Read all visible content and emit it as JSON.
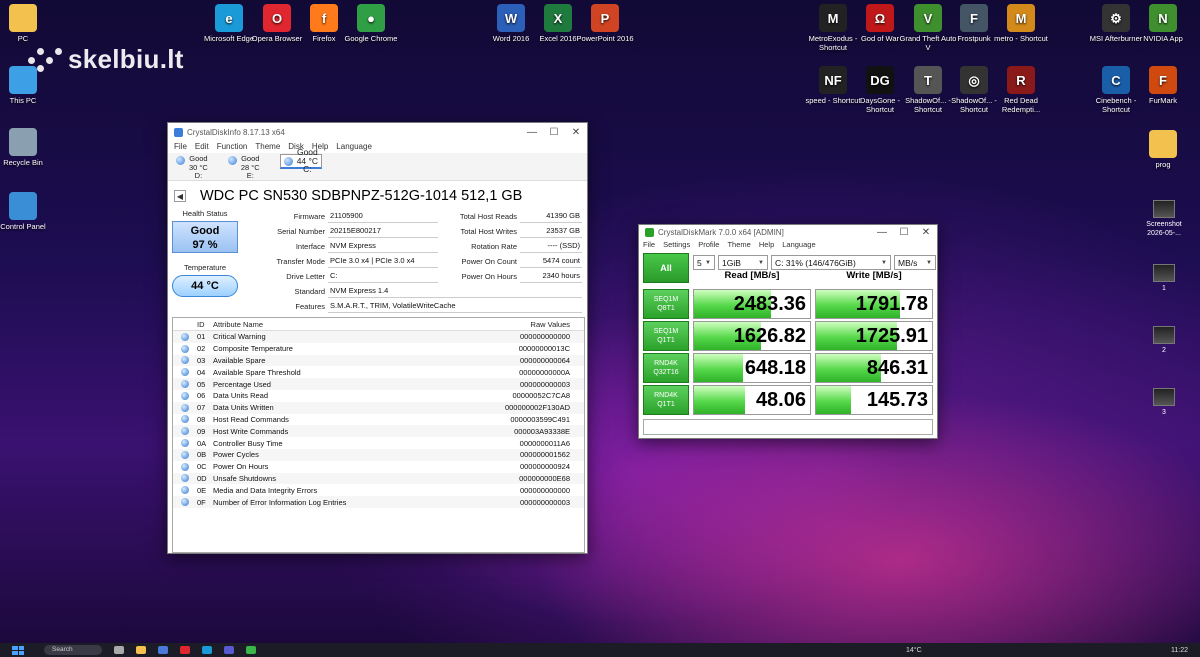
{
  "watermark": "skelbiu.lt",
  "desktop_left": [
    {
      "label": "PC",
      "color": "#f2c14e"
    },
    {
      "label": "This PC",
      "color": "#3da0e6"
    },
    {
      "label": "Recycle Bin",
      "color": "#8aa0b0"
    },
    {
      "label": "Control Panel",
      "color": "#3a8ed6"
    }
  ],
  "desktop_top": [
    {
      "label": "Microsoft Edge",
      "color": "#1a9bd7",
      "glyph": "e"
    },
    {
      "label": "Opera Browser",
      "color": "#e0262e",
      "glyph": "O"
    },
    {
      "label": "Firefox",
      "color": "#ff7a1a",
      "glyph": "f"
    },
    {
      "label": "Google Chrome",
      "color": "#2f9e44",
      "glyph": "●"
    },
    {
      "label": "Word 2016",
      "color": "#2b5fb8",
      "glyph": "W"
    },
    {
      "label": "Excel 2016",
      "color": "#1f7a3e",
      "glyph": "X"
    },
    {
      "label": "PowerPoint 2016",
      "color": "#d04423",
      "glyph": "P"
    },
    {
      "label": "MetroExodus - Shortcut",
      "color": "#222",
      "glyph": "M"
    },
    {
      "label": "God of War",
      "color": "#c01818",
      "glyph": "Ω"
    },
    {
      "label": "Grand Theft Auto V",
      "color": "#3f8f2e",
      "glyph": "V"
    },
    {
      "label": "Frostpunk",
      "color": "#445566",
      "glyph": "F"
    },
    {
      "label": "metro - Shortcut",
      "color": "#d48a1a",
      "glyph": "M"
    },
    {
      "label": "MSI Afterburner",
      "color": "#333",
      "glyph": "⚙"
    },
    {
      "label": "NVIDIA App",
      "color": "#3f8f2e",
      "glyph": "N"
    },
    {
      "label": "speed - Shortcut",
      "color": "#222",
      "glyph": "NF"
    },
    {
      "label": "DaysGone - Shortcut",
      "color": "#111",
      "glyph": "DG"
    },
    {
      "label": "ShadowOf... - Shortcut",
      "color": "#555",
      "glyph": "T"
    },
    {
      "label": "ShadowOf... - Shortcut",
      "color": "#333",
      "glyph": "◎"
    },
    {
      "label": "Red Dead Redempti...",
      "color": "#8a1a1a",
      "glyph": "R"
    },
    {
      "label": "Cinebench - Shortcut",
      "color": "#1a5ea8",
      "glyph": "C"
    },
    {
      "label": "FurMark",
      "color": "#d04a10",
      "glyph": "F"
    },
    {
      "label": "prog",
      "color": "#f2c14e",
      "glyph": ""
    }
  ],
  "desktop_right": [
    {
      "label": "Screenshot 2026-05-..."
    },
    {
      "label": "1"
    },
    {
      "label": "2"
    },
    {
      "label": "3"
    }
  ],
  "cdi": {
    "title": "CrystalDiskInfo 8.17.13 x64",
    "menu": [
      "File",
      "Edit",
      "Function",
      "Theme",
      "Disk",
      "Help",
      "Language"
    ],
    "drives": [
      {
        "status": "Good",
        "temp": "30 °C",
        "letter": "D:"
      },
      {
        "status": "Good",
        "temp": "28 °C",
        "letter": "E:"
      },
      {
        "status": "Good",
        "temp": "44 °C",
        "letter": "C:"
      }
    ],
    "disk_name": "WDC PC SN530 SDBPNPZ-512G-1014 512,1 GB",
    "health_label": "Health Status",
    "health_status": "Good",
    "health_pct": "97 %",
    "temp_label": "Temperature",
    "temp_value": "44 °C",
    "firmware_k": "Firmware",
    "firmware": "21105900",
    "serial_k": "Serial Number",
    "serial": "20215E800217",
    "interface_k": "Interface",
    "interface": "NVM Express",
    "transfer_k": "Transfer Mode",
    "transfer": "PCIe 3.0 x4 | PCIe 3.0 x4",
    "letter_k": "Drive Letter",
    "letter": "C:",
    "standard_k": "Standard",
    "standard": "NVM Express 1.4",
    "features_k": "Features",
    "features": "S.M.A.R.T., TRIM, VolatileWriteCache",
    "reads_k": "Total Host Reads",
    "reads": "41390 GB",
    "writes_k": "Total Host Writes",
    "writes": "23537 GB",
    "rotation_k": "Rotation Rate",
    "rotation": "---- (SSD)",
    "poc_k": "Power On Count",
    "poc": "5474 count",
    "poh_k": "Power On Hours",
    "poh": "2340 hours",
    "col_id": "ID",
    "col_name": "Attribute Name",
    "col_raw": "Raw Values",
    "attrs": [
      {
        "id": "01",
        "name": "Critical Warning",
        "raw": "000000000000"
      },
      {
        "id": "02",
        "name": "Composite Temperature",
        "raw": "00000000013C"
      },
      {
        "id": "03",
        "name": "Available Spare",
        "raw": "000000000064"
      },
      {
        "id": "04",
        "name": "Available Spare Threshold",
        "raw": "00000000000A"
      },
      {
        "id": "05",
        "name": "Percentage Used",
        "raw": "000000000003"
      },
      {
        "id": "06",
        "name": "Data Units Read",
        "raw": "00000052C7CA8"
      },
      {
        "id": "07",
        "name": "Data Units Written",
        "raw": "000000002F130AD"
      },
      {
        "id": "08",
        "name": "Host Read Commands",
        "raw": "0000003599C491"
      },
      {
        "id": "09",
        "name": "Host Write Commands",
        "raw": "000003A93338E"
      },
      {
        "id": "0A",
        "name": "Controller Busy Time",
        "raw": "0000000011A6"
      },
      {
        "id": "0B",
        "name": "Power Cycles",
        "raw": "000000001562"
      },
      {
        "id": "0C",
        "name": "Power On Hours",
        "raw": "000000000924"
      },
      {
        "id": "0D",
        "name": "Unsafe Shutdowns",
        "raw": "000000000E68"
      },
      {
        "id": "0E",
        "name": "Media and Data Integrity Errors",
        "raw": "000000000000"
      },
      {
        "id": "0F",
        "name": "Number of Error Information Log Entries",
        "raw": "000000000003"
      }
    ]
  },
  "cdm": {
    "title": "CrystalDiskMark 7.0.0 x64 [ADMIN]",
    "menu": [
      "File",
      "Settings",
      "Profile",
      "Theme",
      "Help",
      "Language"
    ],
    "all": "All",
    "count": "5",
    "size": "1GiB",
    "drive": "C: 31% (146/476GiB)",
    "unit": "MB/s",
    "read_h": "Read [MB/s]",
    "write_h": "Write [MB/s]",
    "rows": [
      {
        "l1": "SEQ1M",
        "l2": "Q8T1",
        "read": "2483.36",
        "write": "1791.78",
        "read_fill": 0.66,
        "write_fill": 0.72
      },
      {
        "l1": "SEQ1M",
        "l2": "Q1T1",
        "read": "1626.82",
        "write": "1725.91",
        "read_fill": 0.58,
        "write_fill": 0.7
      },
      {
        "l1": "RND4K",
        "l2": "Q32T16",
        "read": "648.18",
        "write": "846.31",
        "read_fill": 0.42,
        "write_fill": 0.56
      },
      {
        "l1": "RND4K",
        "l2": "Q1T1",
        "read": "48.06",
        "write": "145.73",
        "read_fill": 0.44,
        "write_fill": 0.3
      }
    ]
  },
  "taskbar": {
    "search": "Search",
    "weather": "14°C",
    "clock": "11:22"
  }
}
